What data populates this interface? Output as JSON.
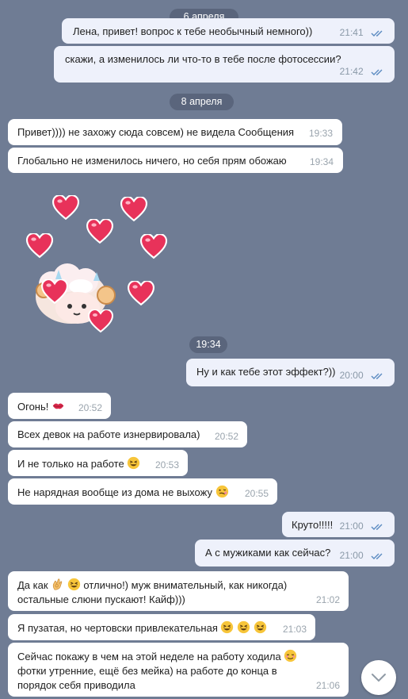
{
  "dates": {
    "d1": "6 апреля",
    "d2": "8 апреля",
    "d3": "19:34"
  },
  "messages": [
    {
      "dir": "out",
      "text": "Лена, привет! вопрос к тебе необычный немного))",
      "time": "21:41"
    },
    {
      "dir": "out",
      "text": "скажи, а изменилось ли что-то в тебе после фотосессии?",
      "time": "21:42"
    },
    {
      "dir": "in",
      "text": "Привет)))) не захожу сюда совсем) не видела Сообщения",
      "time": "19:33"
    },
    {
      "dir": "in",
      "text": "Глобально не изменилось ничего, но себя прям обожаю",
      "time": "19:34"
    },
    {
      "dir": "out",
      "text": "Ну и как тебе этот эффект?))",
      "time": "20:00"
    },
    {
      "dir": "in",
      "text": "Огонь!",
      "time": "20:52"
    },
    {
      "dir": "in",
      "text": "Всех девок на работе изнервировала)",
      "time": "20:52"
    },
    {
      "dir": "in",
      "text": "И не только на работе",
      "time": "20:53"
    },
    {
      "dir": "in",
      "text": "Не нарядная вообще из дома не выхожу",
      "time": "20:55"
    },
    {
      "dir": "out",
      "text": "Круто!!!!!",
      "time": "21:00"
    },
    {
      "dir": "out",
      "text": "А с мужиками как сейчас?",
      "time": "21:00"
    },
    {
      "dir": "in",
      "text_a": "Да как",
      "text_b": "отлично!) муж внимательный, как никогда)",
      "text_c": "остальные слюни пускают! Кайф)))",
      "time": "21:02"
    },
    {
      "dir": "in",
      "text": "Я пузатая, но чертовски привлекательная",
      "time": "21:03"
    },
    {
      "dir": "in",
      "text_a": "Сейчас покажу в чем на этой неделе на работу ходила",
      "text_b": "фотки утренние, ещё без мейка) на работе до конца в порядок себя приводила",
      "time": "21:06"
    }
  ],
  "icons": {
    "read_ticks": "double-check-icon",
    "scroll": "chevron-down-icon"
  },
  "colors": {
    "background": "#6f7c94",
    "incoming": "#ffffff",
    "outgoing": "#eef1fb",
    "ticks": "#5b8bc1"
  }
}
